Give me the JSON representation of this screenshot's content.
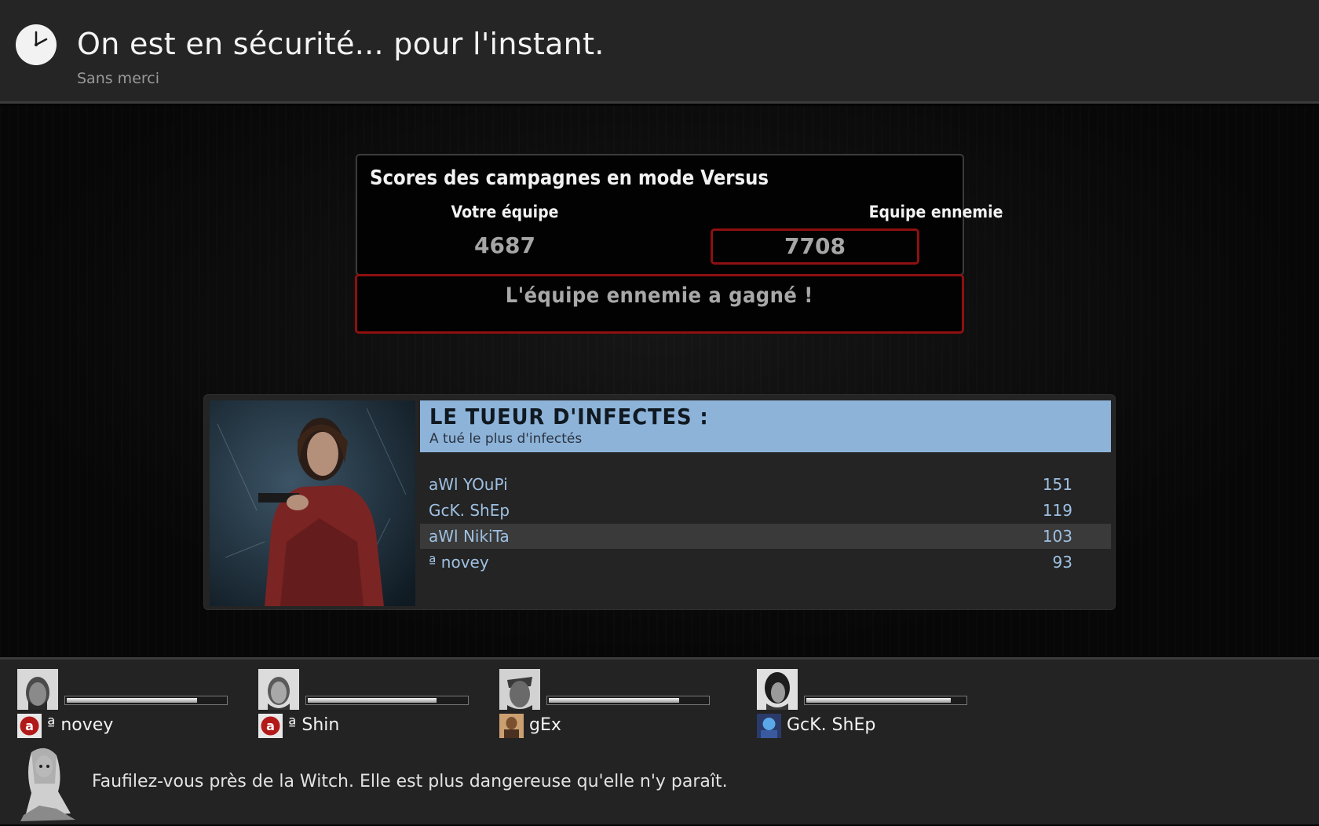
{
  "header": {
    "clock_icon": "clock-icon",
    "title": "On est en sécurité... pour l'instant.",
    "subtitle": "Sans merci"
  },
  "scores": {
    "title": "Scores des campagnes en mode Versus",
    "your_team_label": "Votre équipe",
    "enemy_team_label": "Equipe ennemie",
    "your_team_score": "4687",
    "enemy_team_score": "7708",
    "result": "L'équipe ennemie a gagné !",
    "accent_color": "#8e1010"
  },
  "award": {
    "title": "LE TUEUR D'INFECTES :",
    "description": "A tué le plus d'infectés",
    "header_color": "#8db3d9",
    "rows": [
      {
        "name": "aWl YOuPi",
        "score": "151"
      },
      {
        "name": "GcK. ShEp",
        "score": "119"
      },
      {
        "name": "aWl NikiTa",
        "score": "103"
      },
      {
        "name": "ª novey",
        "score": "93"
      }
    ]
  },
  "players": [
    {
      "name": "ª novey",
      "health": 0.82,
      "icon": "red-a-logo-icon"
    },
    {
      "name": "ª Shin",
      "health": 0.81,
      "icon": "red-a-logo-icon"
    },
    {
      "name": "gEx",
      "health": 0.82,
      "icon": "player-avatar-icon"
    },
    {
      "name": "GcK. ShEp",
      "health": 0.91,
      "icon": "player-avatar-icon"
    }
  ],
  "tip": {
    "icon": "witch-icon",
    "text": "Faufilez-vous près de la Witch. Elle est plus dangereuse qu'elle n'y paraît."
  }
}
